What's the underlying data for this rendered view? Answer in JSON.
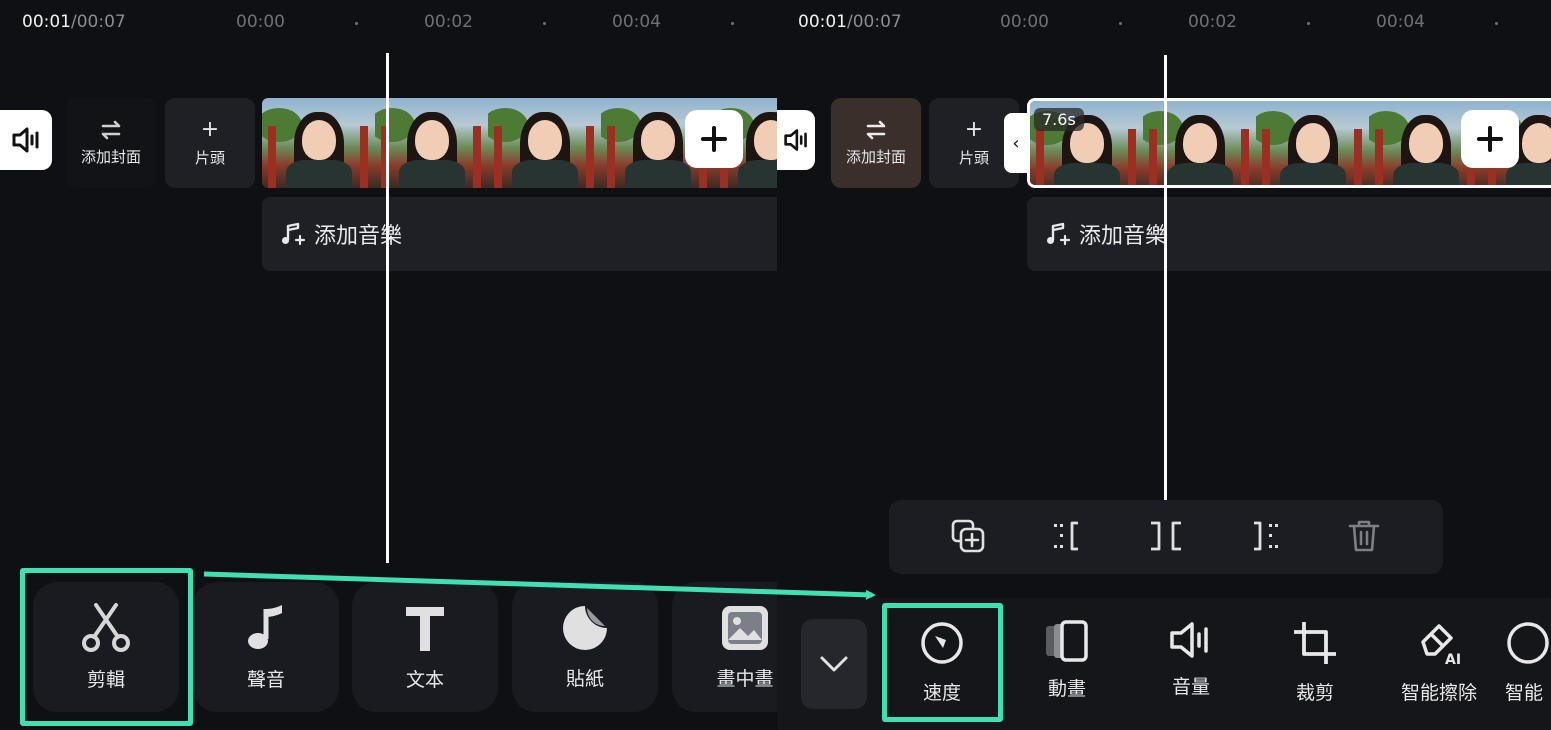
{
  "left": {
    "time_current": "00:01",
    "time_total": "/00:07",
    "ticks": [
      "00:00",
      "00:02",
      "00:04"
    ],
    "cover_label": "添加封面",
    "intro_label": "片頭",
    "music_label": "添加音樂",
    "toolbar": [
      "剪輯",
      "聲音",
      "文本",
      "貼紙",
      "畫中畫"
    ]
  },
  "right": {
    "time_current": "00:01",
    "time_total": "/00:07",
    "ticks": [
      "00:00",
      "00:02",
      "00:04"
    ],
    "cover_label": "添加封面",
    "intro_label": "片頭",
    "clip_duration": "7.6s",
    "music_label": "添加音樂",
    "tools": [
      "速度",
      "動畫",
      "音量",
      "裁剪",
      "智能擦除",
      "智能"
    ]
  },
  "colors": {
    "highlight": "#3fe0b3",
    "background": "#0f1013",
    "tile": "#1e2026"
  },
  "icons": {
    "left_toolbar": [
      "scissors-icon",
      "music-note-icon",
      "text-icon",
      "sticker-icon",
      "picture-in-picture-icon"
    ],
    "edit_bar": [
      "duplicate-icon",
      "split-left-icon",
      "split-icon",
      "split-right-icon",
      "delete-icon"
    ],
    "right_tools": [
      "speed-icon",
      "animation-icon",
      "volume-icon",
      "crop-icon",
      "ai-erase-icon",
      "smart-icon"
    ]
  }
}
